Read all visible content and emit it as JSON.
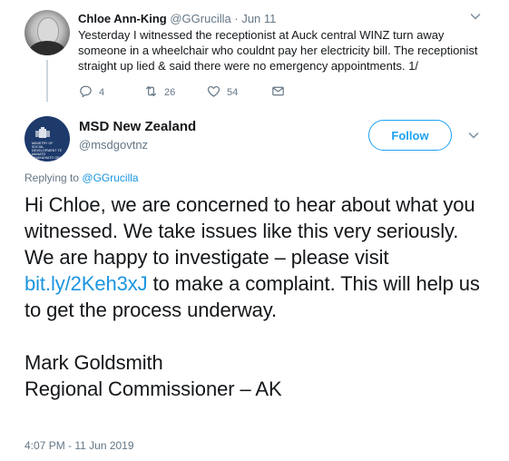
{
  "parent_tweet": {
    "author_name": "Chloe Ann-King",
    "author_handle": "@GGrucilla",
    "separator": "·",
    "time": "Jun 11",
    "text": "Yesterday I witnessed the receptionist at Auck central WINZ turn away someone in a wheelchair who couldnt pay her electricity bill. The receptionist straight up lied & said there were no emergency appointments. 1/",
    "replies": "4",
    "retweets": "26",
    "likes": "54"
  },
  "main_tweet": {
    "author_name": "MSD New Zealand",
    "author_handle": "@msdgovtnz",
    "avatar_text": "MINISTRY OF SOCIAL DEVELOPMENT TE MANATŪ WHAKAHIATO ORA",
    "follow_label": "Follow",
    "replying_prefix": "Replying to",
    "replying_to": "@GGrucilla",
    "text_part1": "Hi Chloe, we are concerned to hear about what you witnessed. We take issues like this very seriously. We are happy to investigate – please visit ",
    "link": "bit.ly/2Keh3xJ",
    "text_part2": " to make a complaint. This will help us to get the process underway.",
    "signature_line1": "Mark Goldsmith",
    "signature_line2": "Regional Commissioner – AK",
    "timestamp": "4:07 PM - 11 Jun 2019"
  },
  "colors": {
    "link_blue": "#1b95e0",
    "follow_blue": "#1da1f2",
    "muted": "#657786",
    "text": "#14171a"
  },
  "icons": [
    "reply-icon",
    "retweet-icon",
    "like-icon",
    "message-icon",
    "chevron-down-icon"
  ]
}
